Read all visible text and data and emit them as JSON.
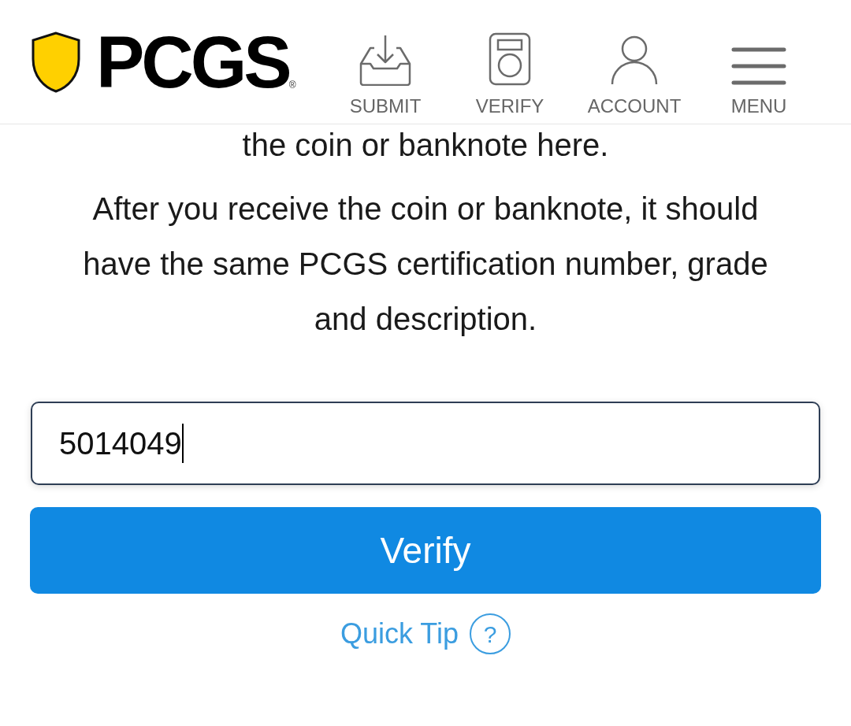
{
  "header": {
    "logo": {
      "text": "PCGS",
      "mark": "®"
    },
    "nav": [
      {
        "kind": "submit",
        "label": "SUBMIT"
      },
      {
        "kind": "verify",
        "label": "VERIFY"
      },
      {
        "kind": "account",
        "label": "ACCOUNT"
      },
      {
        "kind": "menu",
        "label": "MENU"
      }
    ]
  },
  "content": {
    "cut_line": "the coin or banknote here.",
    "paragraph": "After you receive the coin or banknote, it should have the same PCGS certification number, grade and description."
  },
  "cert_field": {
    "value": "5014049",
    "focused": true
  },
  "verify_button": {
    "label": "Verify"
  },
  "quick_tip": {
    "label": "Quick Tip",
    "icon": "?"
  }
}
